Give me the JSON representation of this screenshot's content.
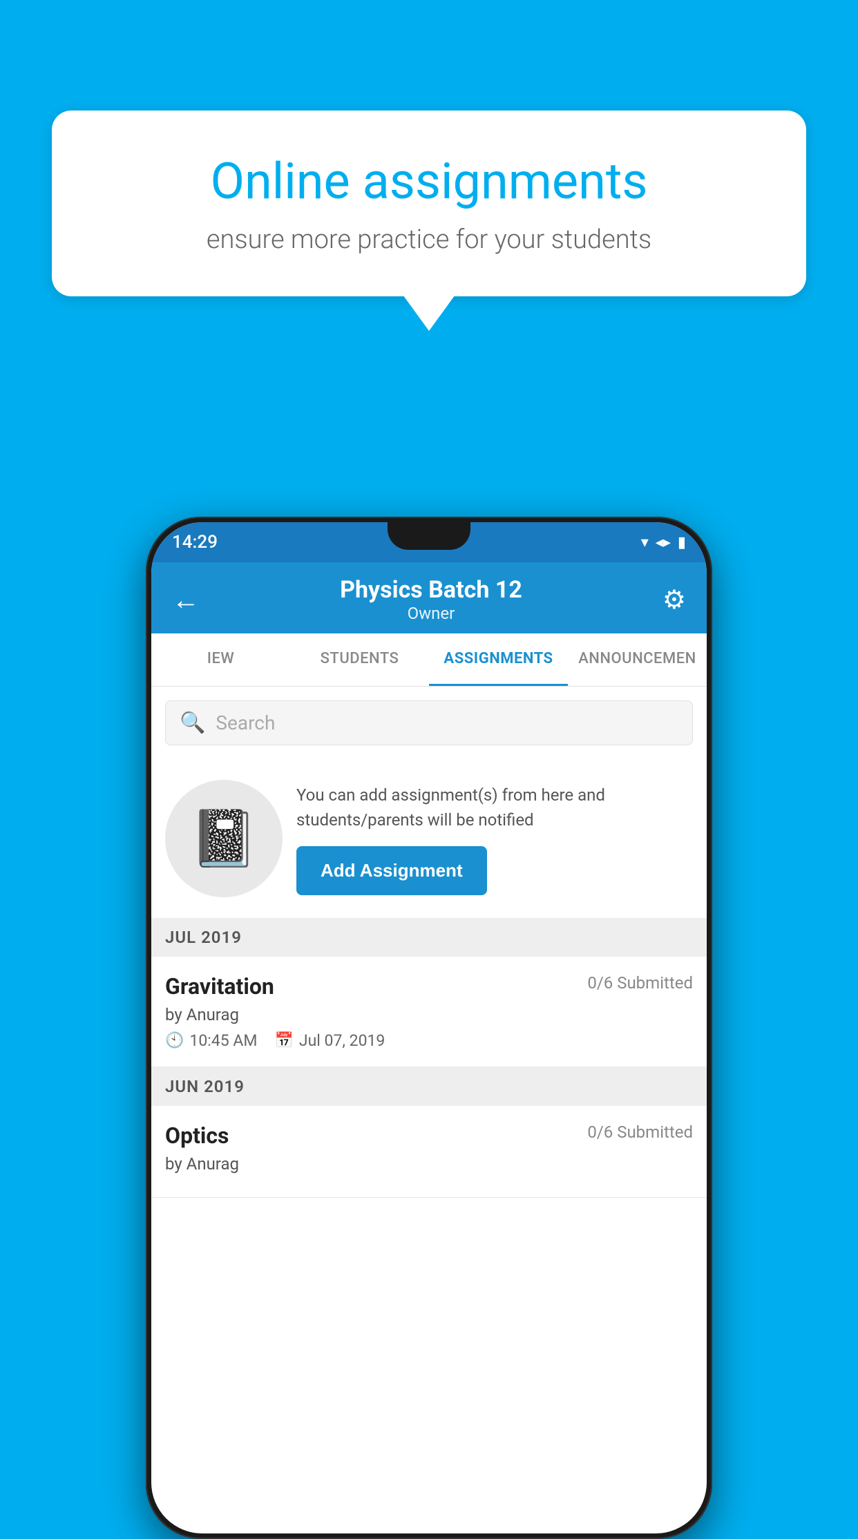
{
  "background_color": "#00AEEF",
  "speech_bubble": {
    "title": "Online assignments",
    "subtitle": "ensure more practice for your students"
  },
  "phone": {
    "status_bar": {
      "time": "14:29",
      "wifi": "▼",
      "signal": "▲",
      "battery": "▮"
    },
    "header": {
      "back_label": "←",
      "title": "Physics Batch 12",
      "subtitle": "Owner",
      "settings_icon": "⚙"
    },
    "tabs": [
      {
        "label": "IEW",
        "active": false
      },
      {
        "label": "STUDENTS",
        "active": false
      },
      {
        "label": "ASSIGNMENTS",
        "active": true
      },
      {
        "label": "ANNOUNCEMENTS",
        "active": false
      }
    ],
    "search": {
      "placeholder": "Search"
    },
    "info_section": {
      "description": "You can add assignment(s) from here and students/parents will be notified",
      "add_button_label": "Add Assignment"
    },
    "sections": [
      {
        "month_label": "JUL 2019",
        "assignments": [
          {
            "title": "Gravitation",
            "status": "0/6 Submitted",
            "author": "by Anurag",
            "time": "10:45 AM",
            "date": "Jul 07, 2019"
          }
        ]
      },
      {
        "month_label": "JUN 2019",
        "assignments": [
          {
            "title": "Optics",
            "status": "0/6 Submitted",
            "author": "by Anurag",
            "time": "",
            "date": ""
          }
        ]
      }
    ]
  }
}
